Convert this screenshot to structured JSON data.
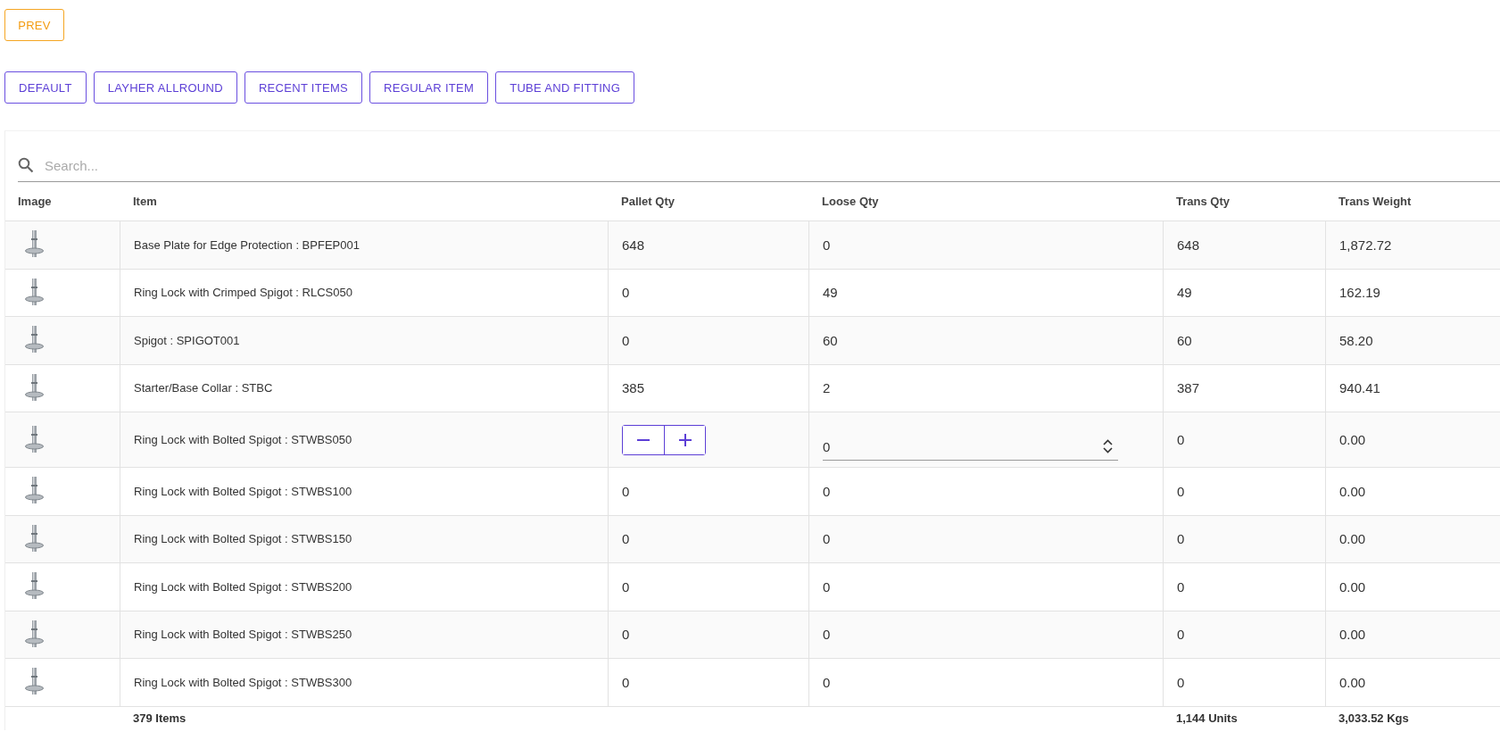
{
  "prev_button": "PREV",
  "categories": [
    "DEFAULT",
    "LAYHER ALLROUND",
    "RECENT ITEMS",
    "REGULAR ITEM",
    "TUBE AND FITTING"
  ],
  "search": {
    "placeholder": "Search..."
  },
  "table": {
    "columns": [
      "Image",
      "Item",
      "Pallet Qty",
      "Loose Qty",
      "Trans Qty",
      "Trans Weight"
    ],
    "rows": [
      {
        "kind": "view",
        "item": "Base Plate for Edge Protection : BPFEP001",
        "pallet_qty": "648",
        "loose_qty": "0",
        "trans_qty": "648",
        "trans_weight": "1,872.72"
      },
      {
        "kind": "view",
        "item": "Ring Lock with Crimped Spigot : RLCS050",
        "pallet_qty": "0",
        "loose_qty": "49",
        "trans_qty": "49",
        "trans_weight": "162.19"
      },
      {
        "kind": "view",
        "item": "Spigot : SPIGOT001",
        "pallet_qty": "0",
        "loose_qty": "60",
        "trans_qty": "60",
        "trans_weight": "58.20"
      },
      {
        "kind": "view",
        "item": "Starter/Base Collar : STBC",
        "pallet_qty": "385",
        "loose_qty": "2",
        "trans_qty": "387",
        "trans_weight": "940.41"
      },
      {
        "kind": "edit",
        "item": "Ring Lock with Bolted Spigot : STWBS050",
        "loose_qty": "0",
        "trans_qty": "0",
        "trans_weight": "0.00"
      },
      {
        "kind": "view",
        "item": "Ring Lock with Bolted Spigot : STWBS100",
        "pallet_qty": "0",
        "loose_qty": "0",
        "trans_qty": "0",
        "trans_weight": "0.00"
      },
      {
        "kind": "view",
        "item": "Ring Lock with Bolted Spigot : STWBS150",
        "pallet_qty": "0",
        "loose_qty": "0",
        "trans_qty": "0",
        "trans_weight": "0.00"
      },
      {
        "kind": "view",
        "item": "Ring Lock with Bolted Spigot : STWBS200",
        "pallet_qty": "0",
        "loose_qty": "0",
        "trans_qty": "0",
        "trans_weight": "0.00"
      },
      {
        "kind": "view",
        "item": "Ring Lock with Bolted Spigot : STWBS250",
        "pallet_qty": "0",
        "loose_qty": "0",
        "trans_qty": "0",
        "trans_weight": "0.00"
      },
      {
        "kind": "view",
        "item": "Ring Lock with Bolted Spigot : STWBS300",
        "pallet_qty": "0",
        "loose_qty": "0",
        "trans_qty": "0",
        "trans_weight": "0.00"
      }
    ],
    "footer": {
      "items": "379 Items",
      "units": "1,144 Units",
      "weight": "3,033.52 Kgs"
    }
  }
}
